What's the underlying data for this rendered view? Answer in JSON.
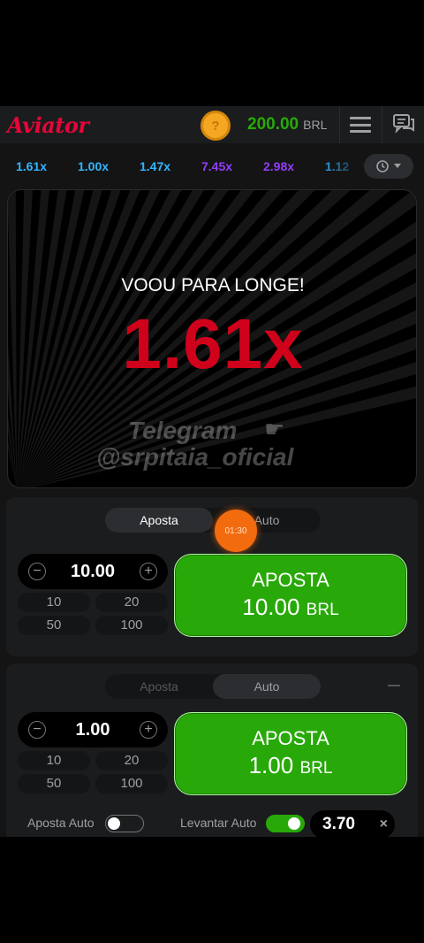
{
  "header": {
    "logo": "Aviator",
    "coin_icon": "question-coin-icon",
    "balance_value": "200.00",
    "balance_currency": "BRL"
  },
  "history": {
    "multipliers": [
      {
        "label": "1.61x",
        "color": "#34b4ff"
      },
      {
        "label": "1.00x",
        "color": "#34b4ff"
      },
      {
        "label": "1.47x",
        "color": "#34b4ff"
      },
      {
        "label": "7.45x",
        "color": "#913ef8"
      },
      {
        "label": "2.98x",
        "color": "#913ef8"
      },
      {
        "label": "1.12",
        "color": "#34b4ff"
      }
    ]
  },
  "game": {
    "flew_away": "VOOU PARA LONGE!",
    "crash_multiplier": "1.61x",
    "watermark_line1": "Telegram",
    "watermark_line2": "@srpitaia_oficial"
  },
  "panel1": {
    "tab_bet": "Aposta",
    "tab_auto": "Auto",
    "amount": "10.00",
    "quick_amounts": [
      "10",
      "20",
      "50",
      "100"
    ],
    "bet_label": "APOSTA",
    "bet_amount": "10.00",
    "bet_currency": "BRL"
  },
  "panel2": {
    "tab_bet": "Aposta",
    "tab_auto": "Auto",
    "amount": "1.00",
    "quick_amounts": [
      "10",
      "20",
      "50",
      "100"
    ],
    "bet_label": "APOSTA",
    "bet_amount": "1.00",
    "bet_currency": "BRL",
    "auto_bet_label": "Aposta Auto",
    "auto_bet_on": false,
    "auto_cashout_label": "Levantar Auto",
    "auto_cashout_on": true,
    "auto_cashout_value": "3.70",
    "clear_symbol": "×"
  },
  "overlay": {
    "timer": "01:30"
  },
  "colors": {
    "brand_red": "#e50539",
    "green": "#28a909",
    "crash_red": "#d0021b",
    "timer_orange": "#f26b0f"
  }
}
